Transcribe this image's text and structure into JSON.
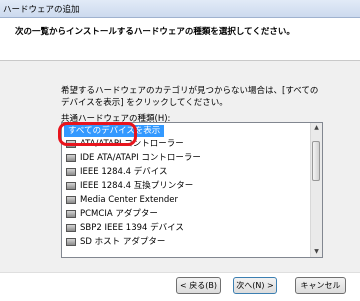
{
  "window": {
    "title": "ハードウェアの追加"
  },
  "header": {
    "instruction": "次の一覧からインストールするハードウェアの種類を選択してください。"
  },
  "main": {
    "description": "希望するハードウェアのカテゴリが見つからない場合は、[すべてのデバイスを表示] をクリックしてください。",
    "list_caption": "共通ハードウェアの種類(H):",
    "items": [
      {
        "label": "すべてのデバイスを表示",
        "icon": "none",
        "selected": true
      },
      {
        "label": "ATA/ATAPI コントローラー",
        "icon": "controller-icon"
      },
      {
        "label": "IDE ATA/ATAPI コントローラー",
        "icon": "controller-icon"
      },
      {
        "label": "IEEE 1284.4 デバイス",
        "icon": "printer-icon"
      },
      {
        "label": "IEEE 1284.4 互換プリンター",
        "icon": "printer-icon"
      },
      {
        "label": "Media Center Extender",
        "icon": "media-icon"
      },
      {
        "label": "PCMCIA アダプター",
        "icon": "card-icon"
      },
      {
        "label": "SBP2 IEEE 1394 デバイス",
        "icon": "device-icon"
      },
      {
        "label": "SD ホスト アダプター",
        "icon": "card-icon"
      }
    ]
  },
  "buttons": {
    "back": "< 戻る(B)",
    "next": "次へ(N) >",
    "cancel": "キャンセル"
  },
  "colors": {
    "selection": "#3399ff",
    "highlight_ring": "#e8141d"
  }
}
